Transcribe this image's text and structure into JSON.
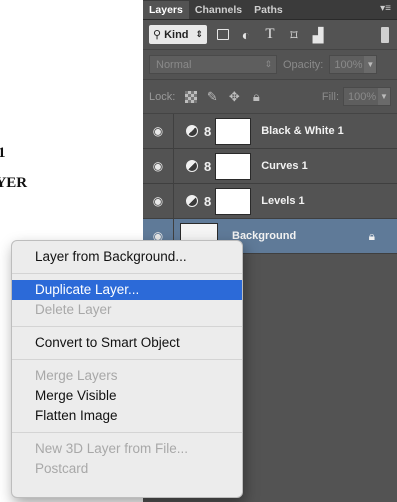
{
  "document": {
    "line1": "1",
    "line2": "AYER"
  },
  "panel": {
    "tabs": [
      {
        "label": "Layers",
        "active": true
      },
      {
        "label": "Channels",
        "active": false
      },
      {
        "label": "Paths",
        "active": false
      }
    ],
    "menu_glyph": "▾≡",
    "filter": {
      "kind_label": "Kind",
      "kind_glyph": "⚲",
      "arrows": "⇕",
      "icons": [
        "image-filter-icon",
        "adjustment-filter-icon",
        "type-filter-icon",
        "shape-filter-icon",
        "smart-object-filter-icon"
      ],
      "type_glyph": "T"
    },
    "blend": {
      "mode": "Normal",
      "opacity_label": "Opacity:",
      "opacity_value": "100%"
    },
    "lock": {
      "label": "Lock:",
      "fill_label": "Fill:",
      "fill_value": "100%"
    },
    "layers": [
      {
        "name": "Black & White 1",
        "type": "adjustment",
        "visible": true
      },
      {
        "name": "Curves 1",
        "type": "adjustment",
        "visible": true
      },
      {
        "name": "Levels 1",
        "type": "adjustment",
        "visible": true
      },
      {
        "name": "Background",
        "type": "pixel",
        "visible": true,
        "selected": true,
        "locked": true
      }
    ]
  },
  "context_menu": {
    "groups": [
      [
        {
          "label": "Layer from Background...",
          "enabled": true
        }
      ],
      [
        {
          "label": "Duplicate Layer...",
          "enabled": true,
          "highlighted": true
        },
        {
          "label": "Delete Layer",
          "enabled": false
        }
      ],
      [
        {
          "label": "Convert to Smart Object",
          "enabled": true
        }
      ],
      [
        {
          "label": "Merge Layers",
          "enabled": false
        },
        {
          "label": "Merge Visible",
          "enabled": true
        },
        {
          "label": "Flatten Image",
          "enabled": true
        }
      ],
      [
        {
          "label": "New 3D Layer from File...",
          "enabled": false
        },
        {
          "label": "Postcard",
          "enabled": false
        }
      ]
    ]
  },
  "colors": {
    "panel_bg": "#535353",
    "selected_layer": "#5f7a98",
    "menu_highlight": "#2c6ad8"
  }
}
